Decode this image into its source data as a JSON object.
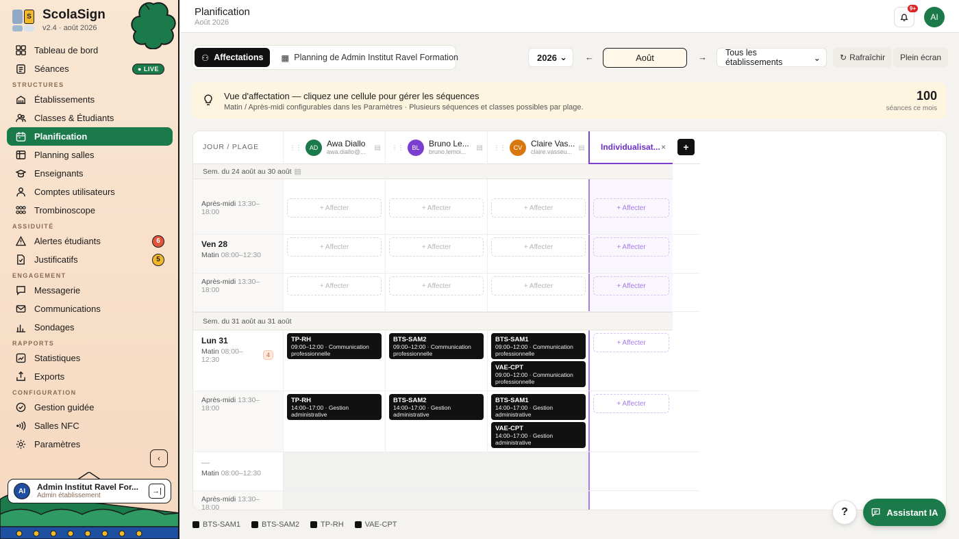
{
  "app": {
    "name": "ScolaSign",
    "version": "v2.4 · août 2026",
    "logo_colors": [
      "#8fa9c7",
      "#f2b82c",
      "#9fb7d1",
      "#d9e2ec"
    ]
  },
  "sidebar": {
    "dashboard": "Tableau de bord",
    "seances": "Séances",
    "live": "LIVE",
    "sec_structures": "STRUCTURES",
    "etablissements": "Établissements",
    "classes": "Classes & Étudiants",
    "planification": "Planification",
    "planning_salles": "Planning salles",
    "enseignants": "Enseignants",
    "comptes": "Comptes utilisateurs",
    "trombi": "Trombinoscope",
    "sec_assiduite": "ASSIDUITÉ",
    "alertes": "Alertes étudiants",
    "alertes_count": "6",
    "justificatifs": "Justificatifs",
    "justificatifs_count": "5",
    "sec_engagement": "ENGAGEMENT",
    "messagerie": "Messagerie",
    "communications": "Communications",
    "sondages": "Sondages",
    "sec_rapports": "RAPPORTS",
    "statistiques": "Statistiques",
    "exports": "Exports",
    "sec_config": "CONFIGURATION",
    "gestion": "Gestion guidée",
    "salles_nfc": "Salles NFC",
    "parametres": "Paramètres",
    "accent": "#1b7a4a"
  },
  "user": {
    "initials": "AI",
    "name": "Admin Institut Ravel For...",
    "role": "Admin établissement"
  },
  "header": {
    "title": "Planification",
    "subtitle": "Août 2026",
    "notif": "9+",
    "avatar": "AI"
  },
  "toolbar": {
    "tab_affectations": "Affectations",
    "tab_planning": "Planning de Admin Institut Ravel Formation",
    "year": "2026",
    "prev": "←",
    "month": "Août",
    "next": "→",
    "etab": "Tous les établissements",
    "refresh": "Rafraîchir",
    "fullscreen": "Plein écran"
  },
  "info": {
    "title": "Vue d'affectation — cliquez une cellule pour gérer les séquences",
    "subtitle": "Matin / Après-midi configurables dans les Paramètres · Plusieurs séquences et classes possibles par plage.",
    "count": "100",
    "count_label": "séances ce mois"
  },
  "grid": {
    "first_col": "JOUR / PLAGE",
    "columns": [
      {
        "initials": "AD",
        "name": "Awa Diallo",
        "email": "awa.diallo@...",
        "color": "#1b7a4a"
      },
      {
        "initials": "BL",
        "name": "Bruno Le...",
        "email": "bruno.lemoi...",
        "color": "#7a3fd1"
      },
      {
        "initials": "CV",
        "name": "Claire Vas...",
        "email": "claire.vasseu...",
        "color": "#d9770f"
      }
    ],
    "indiv": "Individualisat...",
    "indiv_close": "×",
    "add": "+",
    "affecter": "+ Affecter",
    "week1": "Sem. du 24 août au 30 août",
    "week2": "Sem. du 31 août au 31 août",
    "r1_slot": "Après-midi",
    "r1_time": "13:30–18:00",
    "r2_day": "Ven 28",
    "r2_slot": "Matin",
    "r2_time": "08:00–12:30",
    "r3_slot": "Après-midi",
    "r3_time": "13:30–18:00",
    "r4_day": "Lun 31",
    "r4_slot": "Matin",
    "r4_time": "08:00–12:30",
    "r4_count": "4",
    "r5_slot": "Après-midi",
    "r5_time": "13:30–18:00",
    "r6_day": "—",
    "r6_slot": "Matin",
    "r6_time": "08:00–12:30",
    "r7_slot": "Après-midi",
    "r7_time": "13:30–18:00",
    "am": [
      [
        {
          "c": "TP-RH",
          "d": "09:00–12:00 · Communication professionnelle"
        }
      ],
      [
        {
          "c": "BTS-SAM2",
          "d": "09:00–12:00 · Communication professionnelle"
        }
      ],
      [
        {
          "c": "BTS-SAM1",
          "d": "09:00–12:00 · Communication professionnelle"
        },
        {
          "c": "VAE-CPT",
          "d": "09:00–12:00 · Communication professionnelle"
        }
      ]
    ],
    "pm": [
      [
        {
          "c": "TP-RH",
          "d": "14:00–17:00 · Gestion administrative"
        }
      ],
      [
        {
          "c": "BTS-SAM2",
          "d": "14:00–17:00 · Gestion administrative"
        }
      ],
      [
        {
          "c": "BTS-SAM1",
          "d": "14:00–17:00 · Gestion administrative"
        },
        {
          "c": "VAE-CPT",
          "d": "14:00–17:00 · Gestion administrative"
        }
      ]
    ]
  },
  "legend": [
    "BTS-SAM1",
    "BTS-SAM2",
    "TP-RH",
    "VAE-CPT"
  ],
  "help": "?",
  "assistant": "Assistant IA"
}
